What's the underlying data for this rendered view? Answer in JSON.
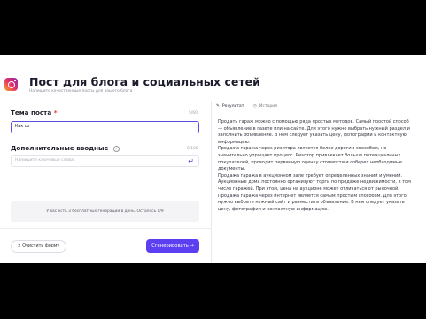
{
  "header": {
    "title": "Пост для блога и социальных сетей",
    "subtitle": "Напишите качественные посты для вашего блога"
  },
  "form": {
    "topic_label": "Тема поста",
    "topic_required": "*",
    "topic_count": "5/60",
    "topic_value": "Как со",
    "keywords_label": "Дополнительные вводные",
    "keywords_info_icon": "i",
    "keywords_count": "0/100",
    "keywords_placeholder": "Напишите ключевые слова",
    "keywords_enter_icon": "↵",
    "quota_text": "У вас есть 3 бесплатных генерации в день. Осталось 0/9"
  },
  "footer": {
    "clear_label": "Очистить форму",
    "clear_icon": "×",
    "generate_label": "Сгенерировать",
    "generate_icon": "→"
  },
  "tabs": [
    {
      "label": "Результат",
      "icon": "✎",
      "active": true
    },
    {
      "label": "История",
      "icon": "◷",
      "active": false
    }
  ],
  "result": {
    "paragraphs": [
      "Продать гараж можно с помощью ряда простых методов. Самый простой способ — объявление в газете или на сайте. Для этого нужно выбрать нужный раздел и заполнить объявление. В нем следует указать цену, фотографии и контактную информацию.",
      "Продажа гаража через риэлтора является более дорогим способом, но значительно упрощает процесс. Риэлтор привлекает больше потенциальных покупателей, проводит первичную оценку стоимости и соберет необходимые документы.",
      "Продажа гаража в аукционном зале требует определенных знаний и умений. Аукционные дома постоянно организуют торги по продаже недвижимости, в том числе гаражей. При этом, цена на аукционе может отличаться от рыночной.",
      "Продажа гаража через интернет является самым простым способом. Для этого нужно выбрать нужный сайт и разместить объявление. В нем следует указать цену, фотографии и контактную информацию."
    ]
  },
  "colors": {
    "accent": "#5b3ff0",
    "required": "#e53935",
    "letterbox": "#000000"
  }
}
